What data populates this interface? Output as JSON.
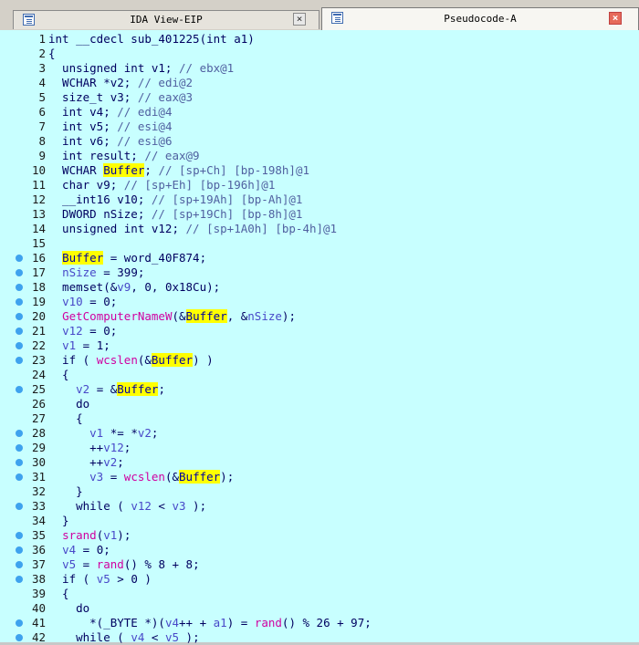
{
  "tabs": [
    {
      "title": "IDA View-EIP",
      "active": false,
      "close": "×"
    },
    {
      "title": "Pseudocode-A",
      "active": true,
      "close": "×"
    }
  ],
  "colors": {
    "code_background": "#c8ffff",
    "highlight": "#ffff00",
    "breakpoint_dot": "#3ea2ee",
    "api_call": "#d000a0",
    "local_var": "#4848c8"
  },
  "lines": [
    {
      "n": "1",
      "bp": false,
      "tokens": [
        {
          "t": "int __cdecl sub_401225(int a1)",
          "c": "plain"
        }
      ]
    },
    {
      "n": "2",
      "bp": false,
      "tokens": [
        {
          "t": "{",
          "c": "plain"
        }
      ]
    },
    {
      "n": "3",
      "bp": false,
      "tokens": [
        {
          "t": "  unsigned int v1; ",
          "c": "plain"
        },
        {
          "t": "// ebx@1",
          "c": "cm"
        }
      ]
    },
    {
      "n": "4",
      "bp": false,
      "tokens": [
        {
          "t": "  WCHAR *v2; ",
          "c": "plain"
        },
        {
          "t": "// edi@2",
          "c": "cm"
        }
      ]
    },
    {
      "n": "5",
      "bp": false,
      "tokens": [
        {
          "t": "  size_t v3; ",
          "c": "plain"
        },
        {
          "t": "// eax@3",
          "c": "cm"
        }
      ]
    },
    {
      "n": "6",
      "bp": false,
      "tokens": [
        {
          "t": "  int v4; ",
          "c": "plain"
        },
        {
          "t": "// edi@4",
          "c": "cm"
        }
      ]
    },
    {
      "n": "7",
      "bp": false,
      "tokens": [
        {
          "t": "  int v5; ",
          "c": "plain"
        },
        {
          "t": "// esi@4",
          "c": "cm"
        }
      ]
    },
    {
      "n": "8",
      "bp": false,
      "tokens": [
        {
          "t": "  int v6; ",
          "c": "plain"
        },
        {
          "t": "// esi@6",
          "c": "cm"
        }
      ]
    },
    {
      "n": "9",
      "bp": false,
      "tokens": [
        {
          "t": "  int result; ",
          "c": "plain"
        },
        {
          "t": "// eax@9",
          "c": "cm"
        }
      ]
    },
    {
      "n": "10",
      "bp": false,
      "tokens": [
        {
          "t": "  WCHAR ",
          "c": "plain"
        },
        {
          "t": "Buffer",
          "c": "hl"
        },
        {
          "t": "; ",
          "c": "plain"
        },
        {
          "t": "// [sp+Ch] [bp-198h]@1",
          "c": "cm"
        }
      ]
    },
    {
      "n": "11",
      "bp": false,
      "tokens": [
        {
          "t": "  char v9; ",
          "c": "plain"
        },
        {
          "t": "// [sp+Eh] [bp-196h]@1",
          "c": "cm"
        }
      ]
    },
    {
      "n": "12",
      "bp": false,
      "tokens": [
        {
          "t": "  __int16 v10; ",
          "c": "plain"
        },
        {
          "t": "// [sp+19Ah] [bp-Ah]@1",
          "c": "cm"
        }
      ]
    },
    {
      "n": "13",
      "bp": false,
      "tokens": [
        {
          "t": "  DWORD nSize; ",
          "c": "plain"
        },
        {
          "t": "// [sp+19Ch] [bp-8h]@1",
          "c": "cm"
        }
      ]
    },
    {
      "n": "14",
      "bp": false,
      "tokens": [
        {
          "t": "  unsigned int v12; ",
          "c": "plain"
        },
        {
          "t": "// [sp+1A0h] [bp-4h]@1",
          "c": "cm"
        }
      ]
    },
    {
      "n": "15",
      "bp": false,
      "tokens": []
    },
    {
      "n": "16",
      "bp": true,
      "tokens": [
        {
          "t": "  ",
          "c": "plain"
        },
        {
          "t": "Buffer",
          "c": "hl"
        },
        {
          "t": " = word_40F874;",
          "c": "plain"
        }
      ]
    },
    {
      "n": "17",
      "bp": true,
      "tokens": [
        {
          "t": "  ",
          "c": "plain"
        },
        {
          "t": "nSize",
          "c": "lv"
        },
        {
          "t": " = 399;",
          "c": "plain"
        }
      ]
    },
    {
      "n": "18",
      "bp": true,
      "tokens": [
        {
          "t": "  memset(&",
          "c": "plain"
        },
        {
          "t": "v9",
          "c": "lv"
        },
        {
          "t": ", 0, 0x18Cu);",
          "c": "plain"
        }
      ]
    },
    {
      "n": "19",
      "bp": true,
      "tokens": [
        {
          "t": "  ",
          "c": "plain"
        },
        {
          "t": "v10",
          "c": "lv"
        },
        {
          "t": " = 0;",
          "c": "plain"
        }
      ]
    },
    {
      "n": "20",
      "bp": true,
      "tokens": [
        {
          "t": "  ",
          "c": "plain"
        },
        {
          "t": "GetComputerNameW",
          "c": "api"
        },
        {
          "t": "(&",
          "c": "plain"
        },
        {
          "t": "Buffer",
          "c": "hl"
        },
        {
          "t": ", &",
          "c": "plain"
        },
        {
          "t": "nSize",
          "c": "lv"
        },
        {
          "t": ");",
          "c": "plain"
        }
      ]
    },
    {
      "n": "21",
      "bp": true,
      "tokens": [
        {
          "t": "  ",
          "c": "plain"
        },
        {
          "t": "v12",
          "c": "lv"
        },
        {
          "t": " = 0;",
          "c": "plain"
        }
      ]
    },
    {
      "n": "22",
      "bp": true,
      "tokens": [
        {
          "t": "  ",
          "c": "plain"
        },
        {
          "t": "v1",
          "c": "lv"
        },
        {
          "t": " = 1;",
          "c": "plain"
        }
      ]
    },
    {
      "n": "23",
      "bp": true,
      "tokens": [
        {
          "t": "  if ( ",
          "c": "plain"
        },
        {
          "t": "wcslen",
          "c": "api"
        },
        {
          "t": "(&",
          "c": "plain"
        },
        {
          "t": "Buffer",
          "c": "hl"
        },
        {
          "t": ") )",
          "c": "plain"
        }
      ]
    },
    {
      "n": "24",
      "bp": false,
      "tokens": [
        {
          "t": "  {",
          "c": "plain"
        }
      ]
    },
    {
      "n": "25",
      "bp": true,
      "tokens": [
        {
          "t": "    ",
          "c": "plain"
        },
        {
          "t": "v2",
          "c": "lv"
        },
        {
          "t": " = &",
          "c": "plain"
        },
        {
          "t": "Buffer",
          "c": "hl"
        },
        {
          "t": ";",
          "c": "plain"
        }
      ]
    },
    {
      "n": "26",
      "bp": false,
      "tokens": [
        {
          "t": "    do",
          "c": "plain"
        }
      ]
    },
    {
      "n": "27",
      "bp": false,
      "tokens": [
        {
          "t": "    {",
          "c": "plain"
        }
      ]
    },
    {
      "n": "28",
      "bp": true,
      "tokens": [
        {
          "t": "      ",
          "c": "plain"
        },
        {
          "t": "v1",
          "c": "lv"
        },
        {
          "t": " *= *",
          "c": "plain"
        },
        {
          "t": "v2",
          "c": "lv"
        },
        {
          "t": ";",
          "c": "plain"
        }
      ]
    },
    {
      "n": "29",
      "bp": true,
      "tokens": [
        {
          "t": "      ++",
          "c": "plain"
        },
        {
          "t": "v12",
          "c": "lv"
        },
        {
          "t": ";",
          "c": "plain"
        }
      ]
    },
    {
      "n": "30",
      "bp": true,
      "tokens": [
        {
          "t": "      ++",
          "c": "plain"
        },
        {
          "t": "v2",
          "c": "lv"
        },
        {
          "t": ";",
          "c": "plain"
        }
      ]
    },
    {
      "n": "31",
      "bp": true,
      "tokens": [
        {
          "t": "      ",
          "c": "plain"
        },
        {
          "t": "v3",
          "c": "lv"
        },
        {
          "t": " = ",
          "c": "plain"
        },
        {
          "t": "wcslen",
          "c": "api"
        },
        {
          "t": "(&",
          "c": "plain"
        },
        {
          "t": "Buffer",
          "c": "hl"
        },
        {
          "t": ");",
          "c": "plain"
        }
      ]
    },
    {
      "n": "32",
      "bp": false,
      "tokens": [
        {
          "t": "    }",
          "c": "plain"
        }
      ]
    },
    {
      "n": "33",
      "bp": true,
      "tokens": [
        {
          "t": "    while ( ",
          "c": "plain"
        },
        {
          "t": "v12",
          "c": "lv"
        },
        {
          "t": " < ",
          "c": "plain"
        },
        {
          "t": "v3",
          "c": "lv"
        },
        {
          "t": " );",
          "c": "plain"
        }
      ]
    },
    {
      "n": "34",
      "bp": false,
      "tokens": [
        {
          "t": "  }",
          "c": "plain"
        }
      ]
    },
    {
      "n": "35",
      "bp": true,
      "tokens": [
        {
          "t": "  ",
          "c": "plain"
        },
        {
          "t": "srand",
          "c": "api"
        },
        {
          "t": "(",
          "c": "plain"
        },
        {
          "t": "v1",
          "c": "lv"
        },
        {
          "t": ");",
          "c": "plain"
        }
      ]
    },
    {
      "n": "36",
      "bp": true,
      "tokens": [
        {
          "t": "  ",
          "c": "plain"
        },
        {
          "t": "v4",
          "c": "lv"
        },
        {
          "t": " = 0;",
          "c": "plain"
        }
      ]
    },
    {
      "n": "37",
      "bp": true,
      "tokens": [
        {
          "t": "  ",
          "c": "plain"
        },
        {
          "t": "v5",
          "c": "lv"
        },
        {
          "t": " = ",
          "c": "plain"
        },
        {
          "t": "rand",
          "c": "api"
        },
        {
          "t": "() % 8 + 8;",
          "c": "plain"
        }
      ]
    },
    {
      "n": "38",
      "bp": true,
      "tokens": [
        {
          "t": "  if ( ",
          "c": "plain"
        },
        {
          "t": "v5",
          "c": "lv"
        },
        {
          "t": " > 0 )",
          "c": "plain"
        }
      ]
    },
    {
      "n": "39",
      "bp": false,
      "tokens": [
        {
          "t": "  {",
          "c": "plain"
        }
      ]
    },
    {
      "n": "40",
      "bp": false,
      "tokens": [
        {
          "t": "    do",
          "c": "plain"
        }
      ]
    },
    {
      "n": "41",
      "bp": true,
      "tokens": [
        {
          "t": "      *(_BYTE *)(",
          "c": "plain"
        },
        {
          "t": "v4",
          "c": "lv"
        },
        {
          "t": "++ + ",
          "c": "plain"
        },
        {
          "t": "a1",
          "c": "lv"
        },
        {
          "t": ") = ",
          "c": "plain"
        },
        {
          "t": "rand",
          "c": "api"
        },
        {
          "t": "() % 26 + 97;",
          "c": "plain"
        }
      ]
    },
    {
      "n": "42",
      "bp": true,
      "tokens": [
        {
          "t": "    while ( ",
          "c": "plain"
        },
        {
          "t": "v4",
          "c": "lv"
        },
        {
          "t": " < ",
          "c": "plain"
        },
        {
          "t": "v5",
          "c": "lv"
        },
        {
          "t": " );",
          "c": "plain"
        }
      ]
    }
  ]
}
